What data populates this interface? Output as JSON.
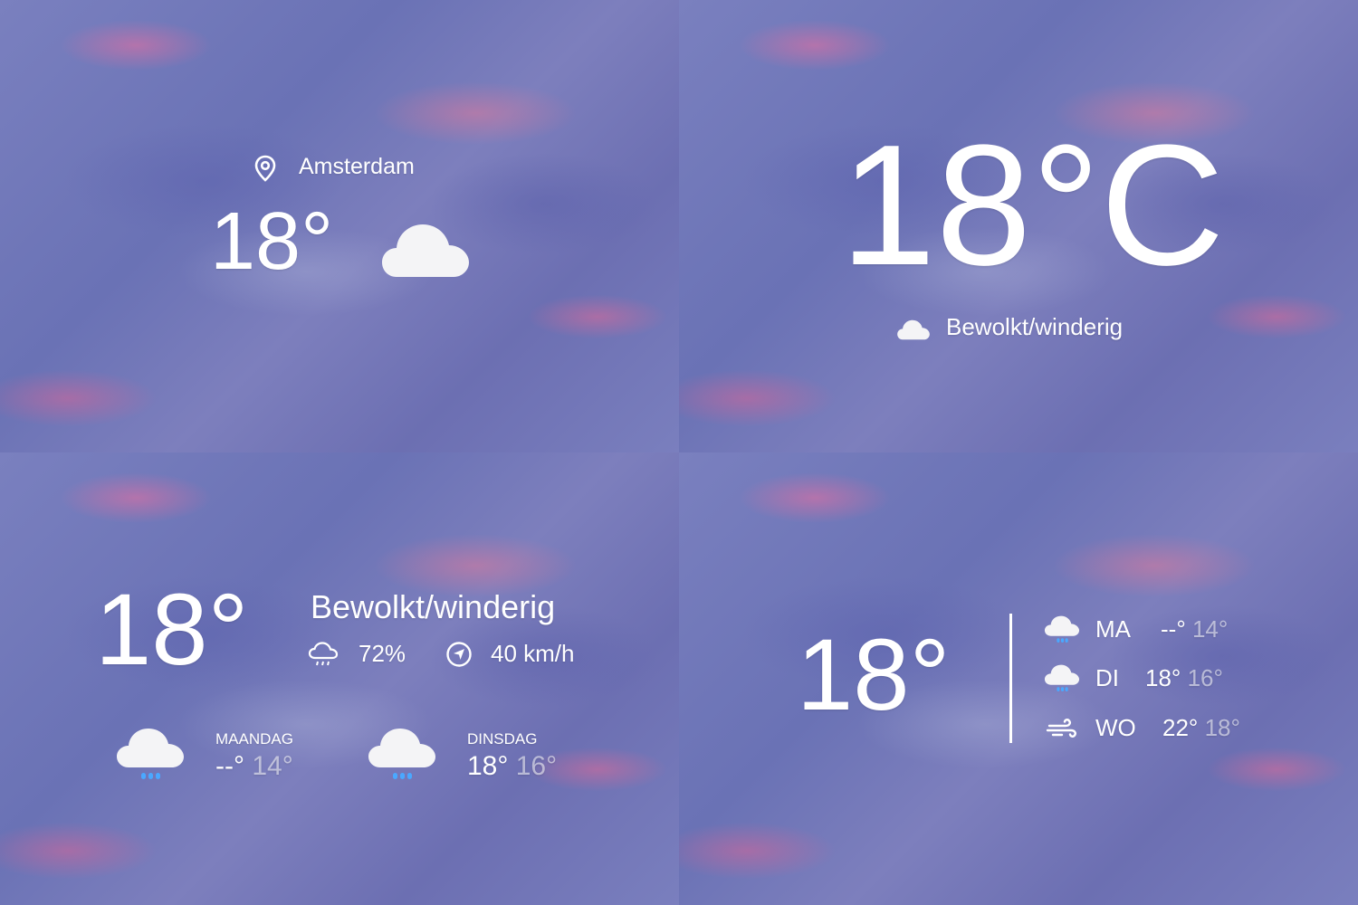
{
  "colors": {
    "text": "#ffffff",
    "muted_text": "#c9cbe2",
    "rain_drops": "#4aa8ff",
    "cloud": "#f2f2f2"
  },
  "panel1": {
    "location_icon": "map-pin-icon",
    "location": "Amsterdam",
    "temperature": "18°",
    "weather_icon": "cloud-icon"
  },
  "panel2": {
    "temperature": "18°C",
    "condition_icon": "cloud-icon",
    "condition": "Bewolkt/winderig"
  },
  "panel3": {
    "temperature": "18°",
    "condition": "Bewolkt/winderig",
    "precipitation_icon": "rain-cloud-outline-icon",
    "precipitation": "72%",
    "wind_icon": "compass-arrow-icon",
    "wind": "40 km/h",
    "forecast": [
      {
        "icon": "rain-cloud-icon",
        "day": "MAANDAG",
        "high": "--°",
        "low": "14°"
      },
      {
        "icon": "rain-cloud-icon",
        "day": "DINSDAG",
        "high": "18°",
        "low": "16°"
      }
    ]
  },
  "panel4": {
    "temperature": "18°",
    "forecast": [
      {
        "icon": "rain-cloud-icon",
        "day": "MA",
        "high": "--°",
        "low": "14°"
      },
      {
        "icon": "rain-cloud-icon",
        "day": "DI",
        "high": "18°",
        "low": "16°"
      },
      {
        "icon": "wind-icon",
        "day": "WO",
        "high": "22°",
        "low": "18°"
      }
    ]
  }
}
